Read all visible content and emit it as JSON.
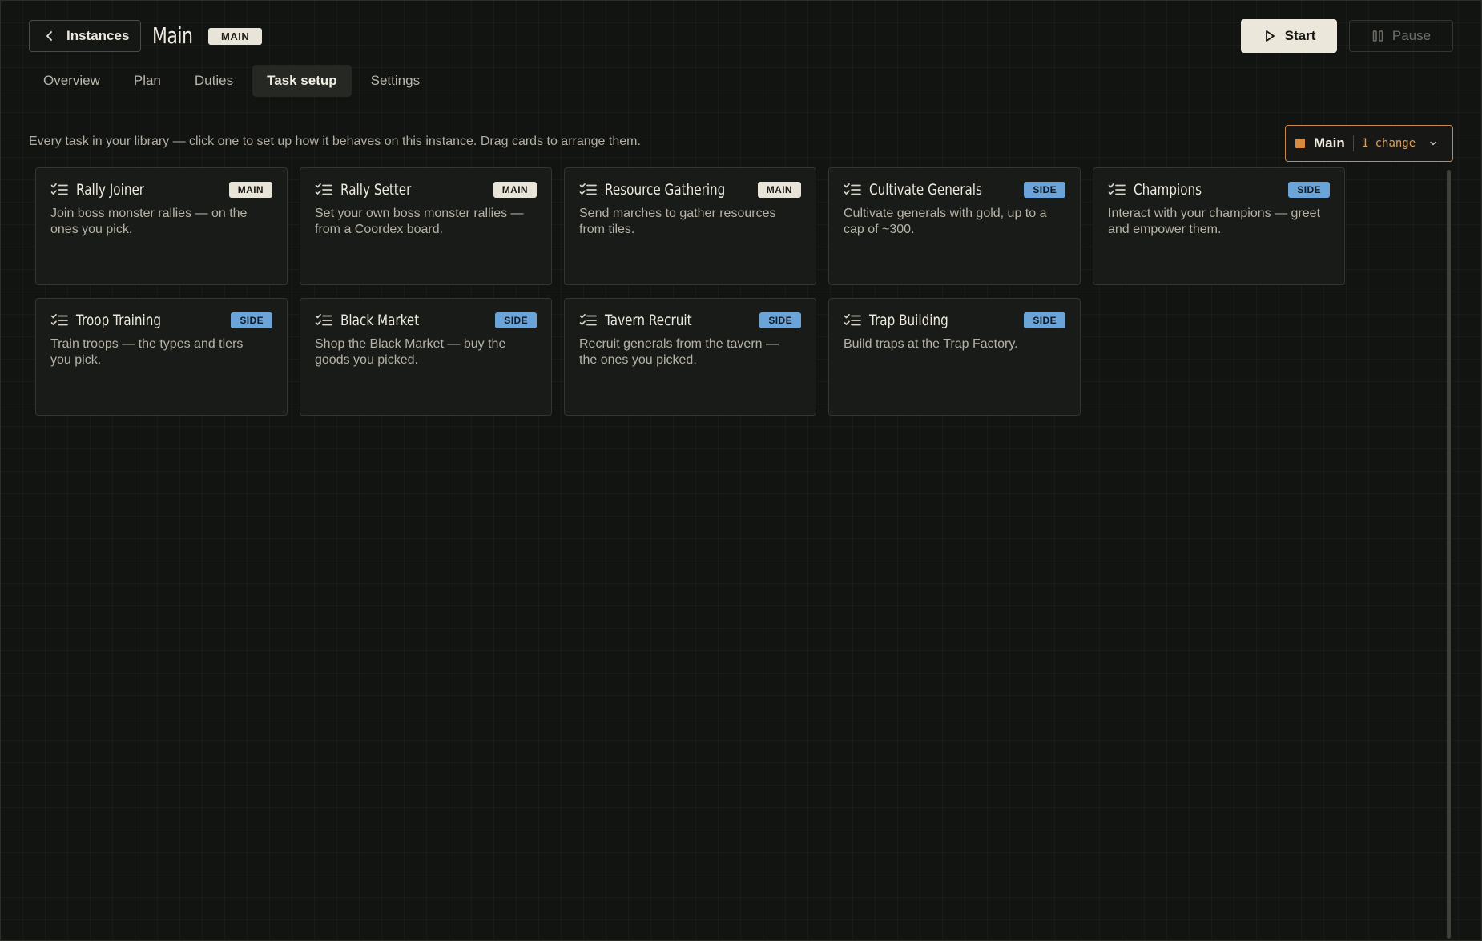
{
  "header": {
    "back_label": "Instances",
    "title": "Main",
    "title_badge": "MAIN",
    "start_label": "Start",
    "pause_label": "Pause"
  },
  "tabs": [
    {
      "label": "Overview",
      "active": false
    },
    {
      "label": "Plan",
      "active": false
    },
    {
      "label": "Duties",
      "active": false
    },
    {
      "label": "Task setup",
      "active": true
    },
    {
      "label": "Settings",
      "active": false
    }
  ],
  "hint": "Every task in your library — click one to set up how it behaves on this instance. Drag cards to arrange them.",
  "profile": {
    "name": "Main",
    "changes": "1 change",
    "accent": "#d98a3f"
  },
  "cards": [
    {
      "title": "Rally Joiner",
      "badge": "MAIN",
      "kind": "main",
      "desc": "Join boss monster rallies — on the ones you pick."
    },
    {
      "title": "Rally Setter",
      "badge": "MAIN",
      "kind": "main",
      "desc": "Set your own boss monster rallies — from a Coordex board."
    },
    {
      "title": "Resource Gathering",
      "badge": "MAIN",
      "kind": "main",
      "desc": "Send marches to gather resources from tiles."
    },
    {
      "title": "Cultivate Generals",
      "badge": "SIDE",
      "kind": "side",
      "desc": "Cultivate generals with gold, up to a cap of ~300."
    },
    {
      "title": "Champions",
      "badge": "SIDE",
      "kind": "side",
      "desc": "Interact with your champions — greet and empower them."
    },
    {
      "title": "Troop Training",
      "badge": "SIDE",
      "kind": "side",
      "desc": "Train troops — the types and tiers you pick."
    },
    {
      "title": "Black Market",
      "badge": "SIDE",
      "kind": "side",
      "desc": "Shop the Black Market — buy the goods you picked."
    },
    {
      "title": "Tavern Recruit",
      "badge": "SIDE",
      "kind": "side",
      "desc": "Recruit generals from the tavern — the ones you picked."
    },
    {
      "title": "Trap Building",
      "badge": "SIDE",
      "kind": "side",
      "desc": "Build traps at the Trap Factory."
    }
  ],
  "colors": {
    "background": "#121412",
    "card": "#191b18",
    "badge_main": "#e8e4d8",
    "badge_side": "#6aa4d8"
  },
  "icons": {
    "back": "chevron-left-icon",
    "start": "play-icon",
    "pause": "pause-icon",
    "card": "checklist-icon",
    "profile": "chevron-down-icon"
  }
}
